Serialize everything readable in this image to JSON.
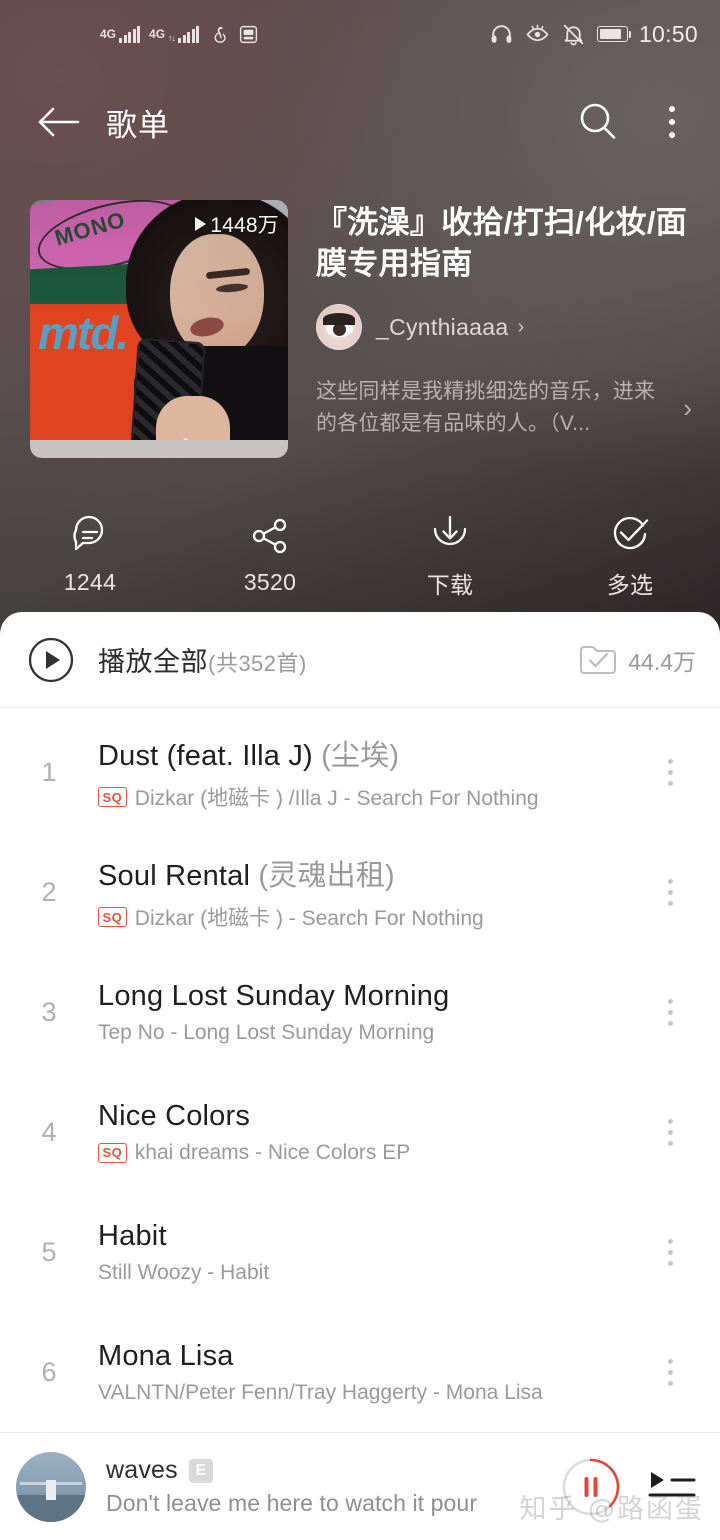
{
  "statusbar": {
    "network_label": "4G",
    "time": "10:50",
    "icons": [
      "signal-4g-sim1",
      "signal-4g-sim2",
      "netease-music-icon",
      "app-icon",
      "headphone-icon",
      "eye-comfort-icon",
      "bell-muted-icon",
      "battery-icon"
    ],
    "battery_level": "73%"
  },
  "topnav": {
    "title": "歌单",
    "back_icon": "back-arrow-icon",
    "search_icon": "search-icon",
    "more_icon": "more-vertical-icon"
  },
  "playlist": {
    "cover_playcount": "1448万",
    "title": "『洗澡』收拾/打扫/化妆/面膜专用指南",
    "author": "_Cynthiaaaa",
    "description": "这些同样是我精挑细选的音乐，进来的各位都是有品味的人。（V...",
    "author_chevron": "›",
    "desc_chevron": "›"
  },
  "actions": [
    {
      "icon": "comment-icon",
      "label": "1244",
      "name": "comment-action"
    },
    {
      "icon": "share-icon",
      "label": "3520",
      "name": "share-action"
    },
    {
      "icon": "download-icon",
      "label": "下载",
      "name": "download-action"
    },
    {
      "icon": "multiselect-icon",
      "label": "多选",
      "name": "multiselect-action"
    }
  ],
  "playall": {
    "label": "播放全部",
    "count": "(共352首)",
    "collect_count": "44.4万",
    "play_icon": "play-circle-icon",
    "collect_icon": "folder-check-icon"
  },
  "songs": [
    {
      "index": "1",
      "title": "Dust (feat. Illa J) ",
      "title_alt": "(尘埃)",
      "quality": "SQ",
      "artist_album": "Dizkar (地磁卡 ) /Illa J - Search For Nothing"
    },
    {
      "index": "2",
      "title": "Soul Rental ",
      "title_alt": "(灵魂出租)",
      "quality": "SQ",
      "artist_album": "Dizkar (地磁卡 ) - Search For Nothing"
    },
    {
      "index": "3",
      "title": "Long Lost Sunday Morning",
      "title_alt": "",
      "quality": "",
      "artist_album": "Tep No - Long Lost Sunday Morning"
    },
    {
      "index": "4",
      "title": "Nice Colors",
      "title_alt": "",
      "quality": "SQ",
      "artist_album": "khai dreams - Nice Colors EP"
    },
    {
      "index": "5",
      "title": "Habit",
      "title_alt": "",
      "quality": "",
      "artist_album": "Still Woozy - Habit"
    },
    {
      "index": "6",
      "title": "Mona Lisa",
      "title_alt": "",
      "quality": "",
      "artist_album": "VALNTN/Peter Fenn/Tray Haggerty - Mona Lisa"
    }
  ],
  "miniplayer": {
    "title": "waves",
    "explicit_badge": "E",
    "lyric": "Don't leave me here to watch it pour",
    "pause_icon": "pause-icon",
    "queue_icon": "play-queue-icon",
    "progress_percent": 28
  },
  "watermark": "知乎 @路函蛋",
  "colors": {
    "accent_red": "#e8443a",
    "quality_badge": "#e2553c",
    "sheet_bg": "#ffffff",
    "hero_left": "#5e474a",
    "hero_right": "#56514f"
  }
}
